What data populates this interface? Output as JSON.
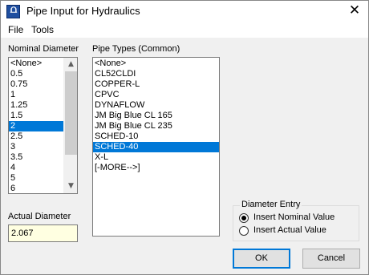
{
  "window": {
    "title": "Pipe Input for Hydraulics",
    "app_icon": "hydraulics-app-icon",
    "close_icon": "close-icon"
  },
  "menu": {
    "file": "File",
    "tools": "Tools"
  },
  "nominal_diameter": {
    "label": "Nominal Diameter",
    "items": [
      "<None>",
      "0.5",
      "0.75",
      "1",
      "1.25",
      "1.5",
      "2",
      "2.5",
      "3",
      "3.5",
      "4",
      "5",
      "6"
    ],
    "selected": "2"
  },
  "pipe_types": {
    "label": "Pipe Types (Common)",
    "items": [
      "<None>",
      "CL52CLDI",
      "COPPER-L",
      "CPVC",
      "DYNAFLOW",
      "JM Big Blue CL 165",
      "JM Big Blue CL 235",
      "SCHED-10",
      "SCHED-40",
      "X-L",
      "[-MORE-->]"
    ],
    "selected": "SCHED-40"
  },
  "actual_diameter": {
    "label": "Actual Diameter",
    "value": "2.067"
  },
  "diameter_entry": {
    "title": "Diameter Entry",
    "options": [
      "Insert Nominal Value",
      "Insert Actual Value"
    ],
    "selected": "Insert Nominal Value"
  },
  "buttons": {
    "ok": "OK",
    "cancel": "Cancel"
  },
  "colors": {
    "selection": "#0078d7",
    "actual_field_bg": "#ffffe1",
    "window_bg": "#f0f0f0"
  }
}
